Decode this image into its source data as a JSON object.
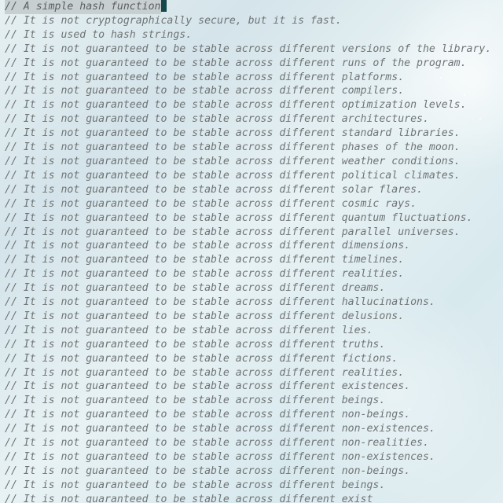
{
  "editor": {
    "first_line_highlight": "// A simple hash function",
    "first_line_after_cursor": "",
    "lines": [
      "// It is not cryptographically secure, but it is fast.",
      "// It is used to hash strings.",
      "// It is not guaranteed to be stable across different versions of the library.",
      "// It is not guaranteed to be stable across different runs of the program.",
      "// It is not guaranteed to be stable across different platforms.",
      "// It is not guaranteed to be stable across different compilers.",
      "// It is not guaranteed to be stable across different optimization levels.",
      "// It is not guaranteed to be stable across different architectures.",
      "// It is not guaranteed to be stable across different standard libraries.",
      "// It is not guaranteed to be stable across different phases of the moon.",
      "// It is not guaranteed to be stable across different weather conditions.",
      "// It is not guaranteed to be stable across different political climates.",
      "// It is not guaranteed to be stable across different solar flares.",
      "// It is not guaranteed to be stable across different cosmic rays.",
      "// It is not guaranteed to be stable across different quantum fluctuations.",
      "// It is not guaranteed to be stable across different parallel universes.",
      "// It is not guaranteed to be stable across different dimensions.",
      "// It is not guaranteed to be stable across different timelines.",
      "// It is not guaranteed to be stable across different realities.",
      "// It is not guaranteed to be stable across different dreams.",
      "// It is not guaranteed to be stable across different hallucinations.",
      "// It is not guaranteed to be stable across different delusions.",
      "// It is not guaranteed to be stable across different lies.",
      "// It is not guaranteed to be stable across different truths.",
      "// It is not guaranteed to be stable across different fictions.",
      "// It is not guaranteed to be stable across different realities.",
      "// It is not guaranteed to be stable across different existences.",
      "// It is not guaranteed to be stable across different beings.",
      "// It is not guaranteed to be stable across different non-beings.",
      "// It is not guaranteed to be stable across different non-existences.",
      "// It is not guaranteed to be stable across different non-realities.",
      "// It is not guaranteed to be stable across different non-existences.",
      "// It is not guaranteed to be stable across different non-beings.",
      "// It is not guaranteed to be stable across different beings.",
      "// It is not guaranteed to be stable across different exist"
    ]
  }
}
